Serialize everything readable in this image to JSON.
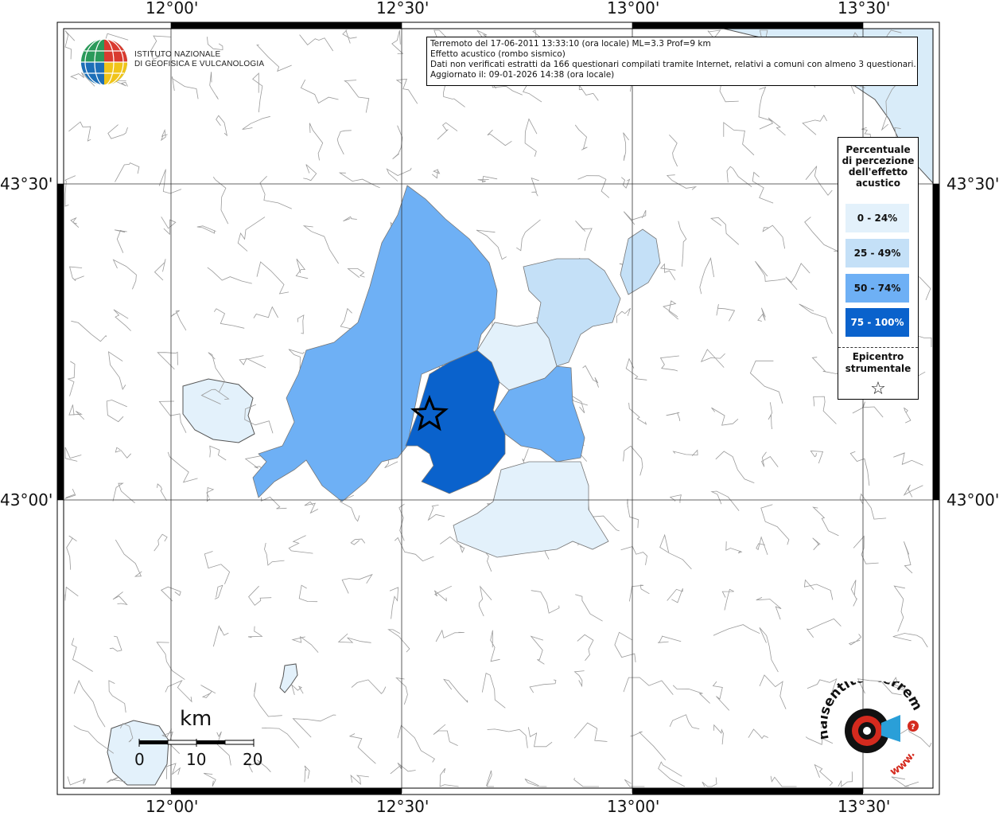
{
  "map": {
    "lon_ticks": [
      "12°00'",
      "12°30'",
      "13°00'",
      "13°30'"
    ],
    "lat_ticks": [
      "43°30'",
      "43°00'"
    ],
    "colors": {
      "class_0_24": "#e3f1fb",
      "class_25_49": "#c4e0f7",
      "class_50_74": "#6eb0f5",
      "class_75_100": "#0a62cc",
      "sea": "#d9ecf9",
      "boundary": "#9a9a9a"
    }
  },
  "info": {
    "line1": "Terremoto del 17-06-2011 13:33:10 (ora locale) ML=3.3 Prof=9 km",
    "line2": "Effetto acustico (rombo sismico)",
    "line3": "Dati non verificati estratti da 166 questionari compilati tramite Internet, relativi a comuni con almeno 3 questionari.",
    "line4": "Aggiornato il: 09-01-2026 14:38 (ora locale)"
  },
  "legend": {
    "title_lines": [
      "Percentuale",
      "di percezione",
      "dell'effetto",
      "acustico"
    ],
    "items": [
      {
        "label": "0 - 24%",
        "color": "#e3f1fb",
        "text_color": "#111111"
      },
      {
        "label": "25 - 49%",
        "color": "#c4e0f7",
        "text_color": "#111111"
      },
      {
        "label": "50 - 74%",
        "color": "#6eb0f5",
        "text_color": "#111111"
      },
      {
        "label": "75 - 100%",
        "color": "#0a62cc",
        "text_color": "#ffffff"
      }
    ],
    "epicenter_lines": [
      "Epicentro",
      "strumentale"
    ],
    "epicenter_symbol": "☆"
  },
  "logos": {
    "ingv_line1": "ISTITUTO NAZIONALE",
    "ingv_line2": "DI GEOFISICA E VULCANOLOGIA",
    "hst_text": "haisentitoilterremoto.it",
    "hst_www": "www."
  },
  "scale": {
    "unit": "km",
    "ticks": [
      "0",
      "10",
      "20"
    ]
  }
}
